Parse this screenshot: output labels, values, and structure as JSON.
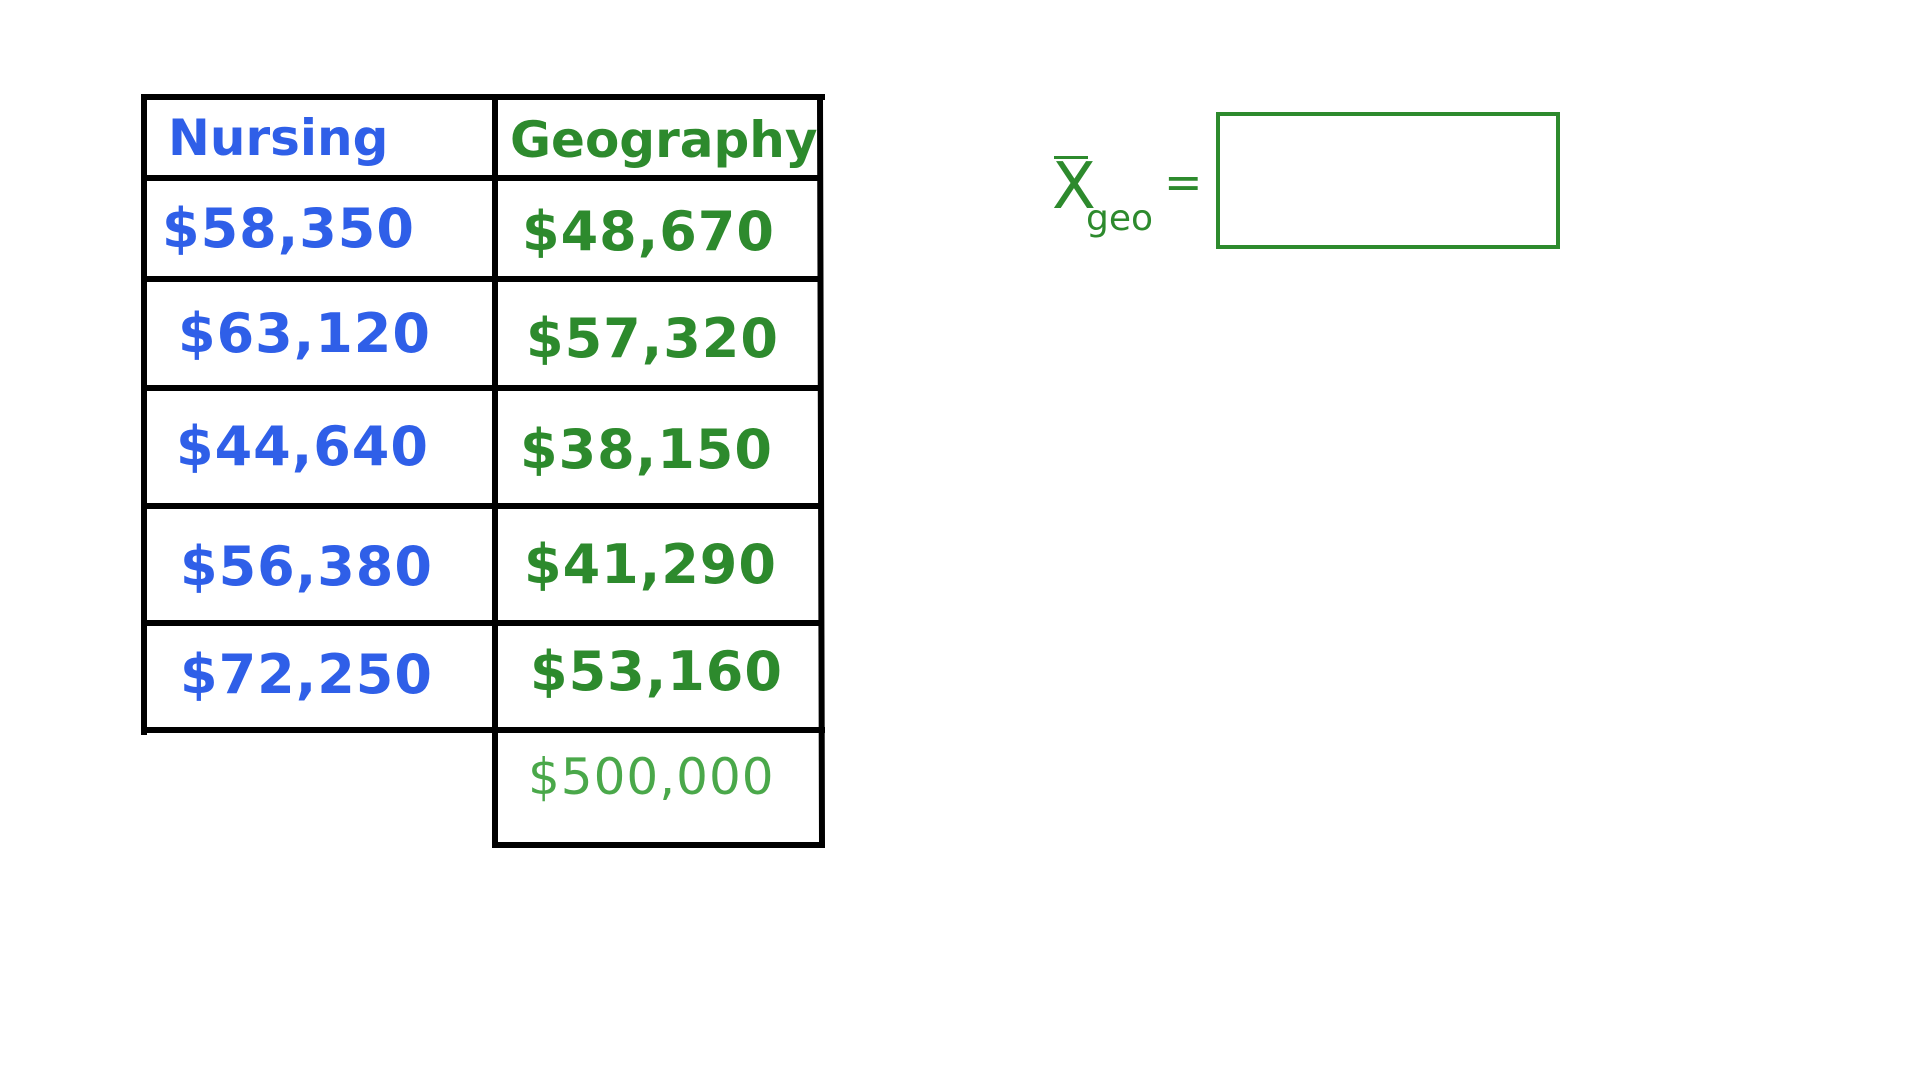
{
  "table": {
    "headers": {
      "nursing": "Nursing",
      "geography": "Geography"
    },
    "nursing_values": [
      "$58,350",
      "$63,120",
      "$44,640",
      "$56,380",
      "$72,250"
    ],
    "geography_values": [
      "$48,670",
      "$57,320",
      "$38,150",
      "$41,290",
      "$53,160",
      "$500,000"
    ]
  },
  "formula": {
    "symbol": "X",
    "subscript": "geo",
    "equals": "="
  },
  "colors": {
    "nursing": "#2f5fe8",
    "geography": "#2d8a2d",
    "geography_outlier": "#4aa84a",
    "grid": "#000000"
  }
}
